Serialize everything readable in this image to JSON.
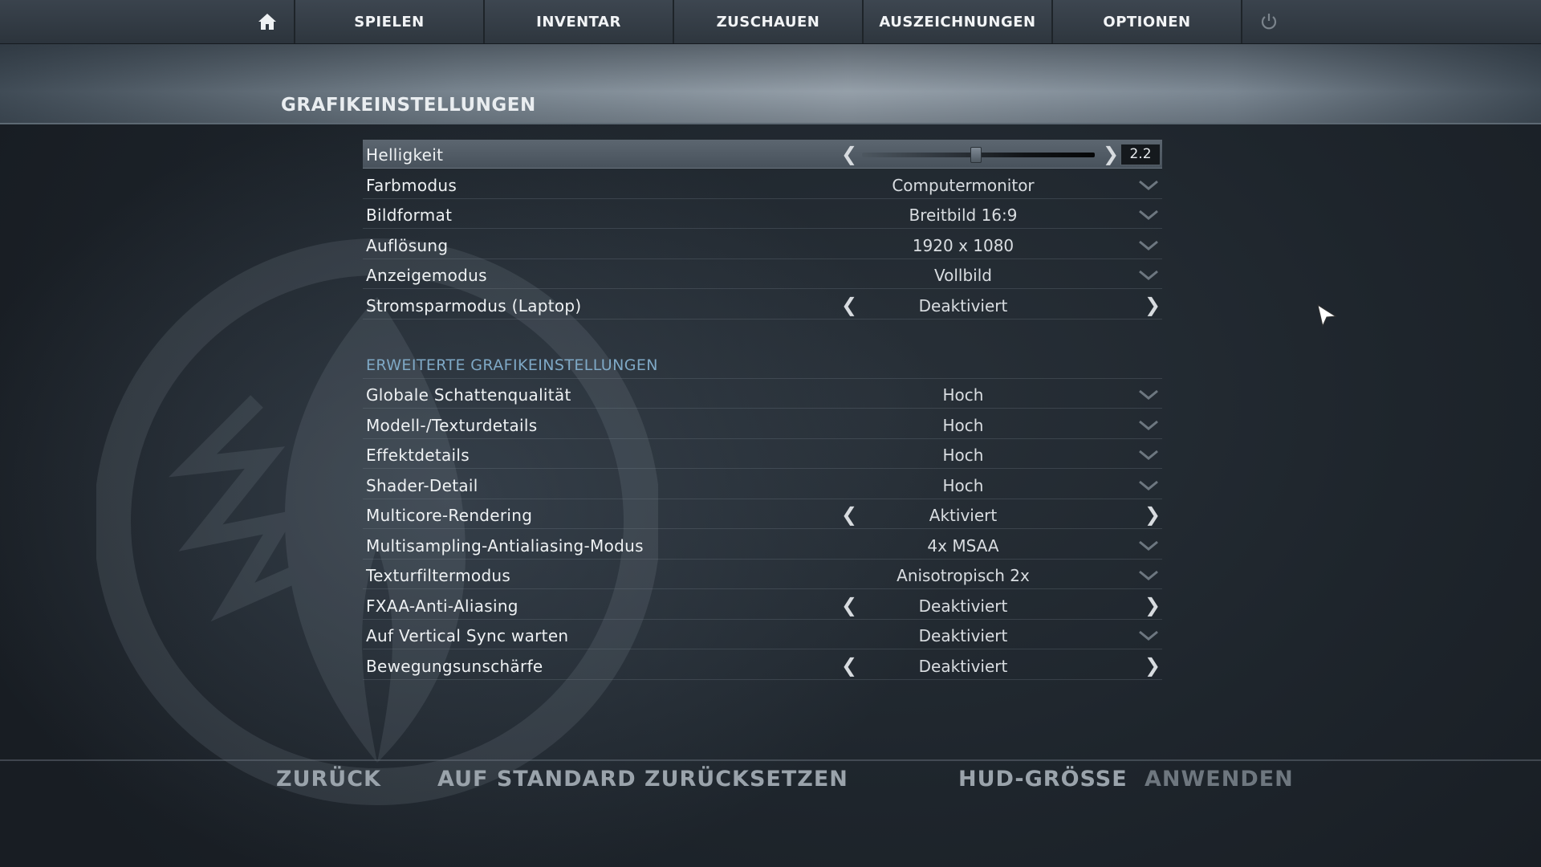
{
  "nav": {
    "home_icon": "home-icon",
    "tabs": [
      {
        "label": "SPIELEN"
      },
      {
        "label": "INVENTAR"
      },
      {
        "label": "ZUSCHAUEN"
      },
      {
        "label": "AUSZEICHNUNGEN"
      },
      {
        "label": "OPTIONEN"
      }
    ],
    "power_icon": "power-icon"
  },
  "page": {
    "title": "GRAFIKEINSTELLUNGEN"
  },
  "brightness": {
    "label": "Helligkeit",
    "value": "2.2",
    "slider_fraction": 0.49
  },
  "basic_settings": [
    {
      "label": "Farbmodus",
      "value": "Computermonitor",
      "control": "dropdown"
    },
    {
      "label": "Bildformat",
      "value": "Breitbild 16:9",
      "control": "dropdown"
    },
    {
      "label": "Auflösung",
      "value": "1920 x 1080",
      "control": "dropdown"
    },
    {
      "label": "Anzeigemodus",
      "value": "Vollbild",
      "control": "dropdown"
    },
    {
      "label": "Stromsparmodus (Laptop)",
      "value": "Deaktiviert",
      "control": "toggle"
    }
  ],
  "advanced": {
    "title": "ERWEITERTE GRAFIKEINSTELLUNGEN",
    "settings": [
      {
        "label": "Globale Schattenqualität",
        "value": "Hoch",
        "control": "dropdown"
      },
      {
        "label": "Modell-/Texturdetails",
        "value": "Hoch",
        "control": "dropdown"
      },
      {
        "label": "Effektdetails",
        "value": "Hoch",
        "control": "dropdown"
      },
      {
        "label": "Shader-Detail",
        "value": "Hoch",
        "control": "dropdown"
      },
      {
        "label": "Multicore-Rendering",
        "value": "Aktiviert",
        "control": "toggle"
      },
      {
        "label": "Multisampling-Antialiasing-Modus",
        "value": "4x MSAA",
        "control": "dropdown"
      },
      {
        "label": "Texturfiltermodus",
        "value": "Anisotropisch 2x",
        "control": "dropdown"
      },
      {
        "label": "FXAA-Anti-Aliasing",
        "value": "Deaktiviert",
        "control": "toggle"
      },
      {
        "label": "Auf Vertical Sync warten",
        "value": "Deaktiviert",
        "control": "dropdown"
      },
      {
        "label": "Bewegungsunschärfe",
        "value": "Deaktiviert",
        "control": "toggle"
      }
    ]
  },
  "footer": {
    "back": "ZURÜCK",
    "reset": "AUF STANDARD ZURÜCKSETZEN",
    "hud_size": "HUD-GRÖSSE",
    "apply": "ANWENDEN"
  },
  "colors": {
    "accent": "#7fa9c6",
    "text": "#eef1f3",
    "highlight_row": "#5c6670",
    "disabled": "#6e777f"
  }
}
